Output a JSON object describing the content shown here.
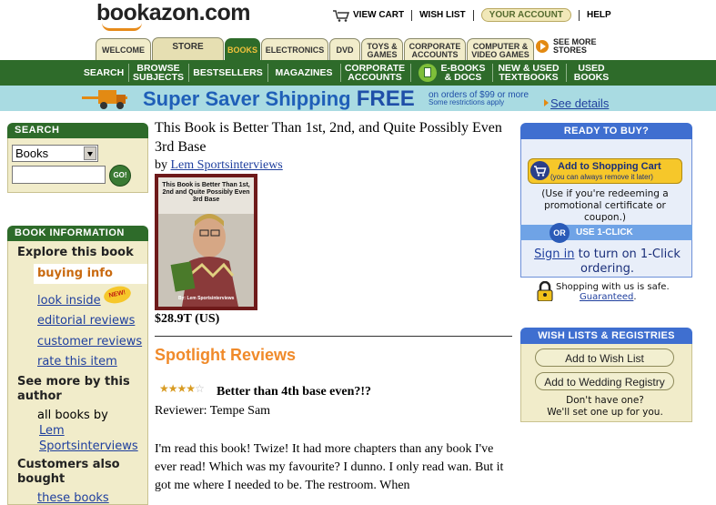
{
  "header": {
    "logo": "bookazon.com",
    "links": {
      "view_cart": "VIEW CART",
      "wish_list": "WISH LIST",
      "your_account": "YOUR ACCOUNT",
      "help": "HELP"
    }
  },
  "tabs": [
    {
      "label": "WELCOME"
    },
    {
      "label": "STORE"
    },
    {
      "label": "BOOKS"
    },
    {
      "label": "ELECTRONICS"
    },
    {
      "label": "DVD"
    },
    {
      "label": "TOYS &\nGAMES"
    },
    {
      "label": "CORPORATE\nACCOUNTS"
    },
    {
      "label": "COMPUTER &\nVIDEO GAMES"
    }
  ],
  "see_more": "SEE MORE\nSTORES",
  "nav": [
    {
      "label": "SEARCH"
    },
    {
      "label": "BROWSE\nSUBJECTS"
    },
    {
      "label": "BESTSELLERS"
    },
    {
      "label": "MAGAZINES"
    },
    {
      "label": "CORPORATE\nACCOUNTS"
    },
    {
      "label": "E-BOOKS\n& DOCS"
    },
    {
      "label": "NEW & USED\nTEXTBOOKS"
    },
    {
      "label": "USED\nBOOKS"
    }
  ],
  "banner": {
    "title": "Super Saver Shipping",
    "free": "FREE",
    "small_line1": "on orders of $99 or more",
    "small_line2": "Some restrictions apply",
    "link": "See details"
  },
  "search_box": {
    "heading": "SEARCH",
    "select_value": "Books",
    "go": "GO!"
  },
  "book_info": {
    "heading": "BOOK INFORMATION",
    "explore": "Explore this book",
    "buying_info": "buying info",
    "look_inside": "look inside",
    "new_badge": "NEW!",
    "editorial_reviews": "editorial reviews",
    "customer_reviews": "customer reviews",
    "rate_this_item": "rate this item",
    "see_more_author": "See more by this author",
    "all_books_by": "all books by",
    "author_link_1": "Lem",
    "author_link_2": "Sportsinterviews",
    "customers_also": "Customers also bought",
    "these_books": "these books"
  },
  "product": {
    "title": "This Book is Better Than 1st, 2nd, and Quite Possibly Even 3rd Base",
    "by": "by",
    "author": "Lem Sportsinterviews",
    "cover_title": "This Book is Better Than 1st, 2nd and Quite Possibly Even 3rd Base",
    "cover_author": "By: Lem Sportsinterviews",
    "price": "$28.9T (US)"
  },
  "reviews": {
    "heading": "Spotlight Reviews",
    "rating": 4,
    "rating_max": 5,
    "review_title": "Better than 4th base even?!?",
    "reviewer": "Reviewer: Tempe Sam",
    "body": "I'm read this book! Twize! It had more chapters than any book I've ever read! Which was my favourite? I dunno. I only read wan. But it got me where I needed to be. The restroom. When"
  },
  "ready_to_buy": {
    "heading": "READY TO BUY?",
    "add_to_cart": "Add to Shopping Cart",
    "add_to_cart_sub": "(you can always remove it later)",
    "redeem": "(Use if you're redeeming a promotional certificate or coupon.)",
    "or": "OR",
    "one_click": "USE 1-CLICK",
    "sign_in": "Sign in",
    "sign_in_rest": "to turn on 1-Click ordering.",
    "safe_1": "Shopping with us is safe.",
    "guaranteed": "Guaranteed"
  },
  "wish_lists": {
    "heading": "WISH LISTS & REGISTRIES",
    "add_wish": "Add to Wish List",
    "add_wedding": "Add to Wedding Registry",
    "dont_have": "Don't have one?\nWe'll set one up for you."
  },
  "colors": {
    "green": "#2e6b2a",
    "tan": "#f1ecca",
    "orange": "#f08a2a",
    "blue_header": "#3f6fd0",
    "link": "#1f3f9e"
  }
}
